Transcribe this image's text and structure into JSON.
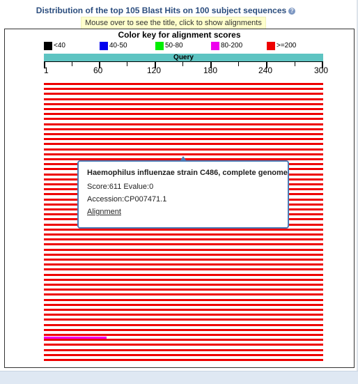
{
  "header": {
    "title": "Distribution of the top 105 Blast Hits on 100 subject sequences",
    "help_icon": "?",
    "hint": "Mouse over to see the title, click to show alignments"
  },
  "color_key": {
    "title": "Color key for alignment scores",
    "items": [
      {
        "label": "<40",
        "color": "#000000"
      },
      {
        "label": "40-50",
        "color": "#0000ee"
      },
      {
        "label": "50-80",
        "color": "#00ee00"
      },
      {
        "label": "80-200",
        "color": "#ee00ee"
      },
      {
        "label": ">=200",
        "color": "#ee0000"
      }
    ]
  },
  "query": {
    "label": "Query",
    "ticks": [
      "1",
      "60",
      "120",
      "180",
      "240",
      "300"
    ]
  },
  "hits": {
    "count_rows": 56,
    "pink_row_index": 50,
    "pink_fraction": 0.225,
    "colors": {
      "high": "#ee0000",
      "mid": "#ee00ee"
    }
  },
  "tooltip": {
    "title": "Haemophilus influenzae strain C486, complete genome",
    "score": "Score:611 Evalue:0",
    "accession": "Accession:CP007471.1",
    "link": "Alignment"
  }
}
